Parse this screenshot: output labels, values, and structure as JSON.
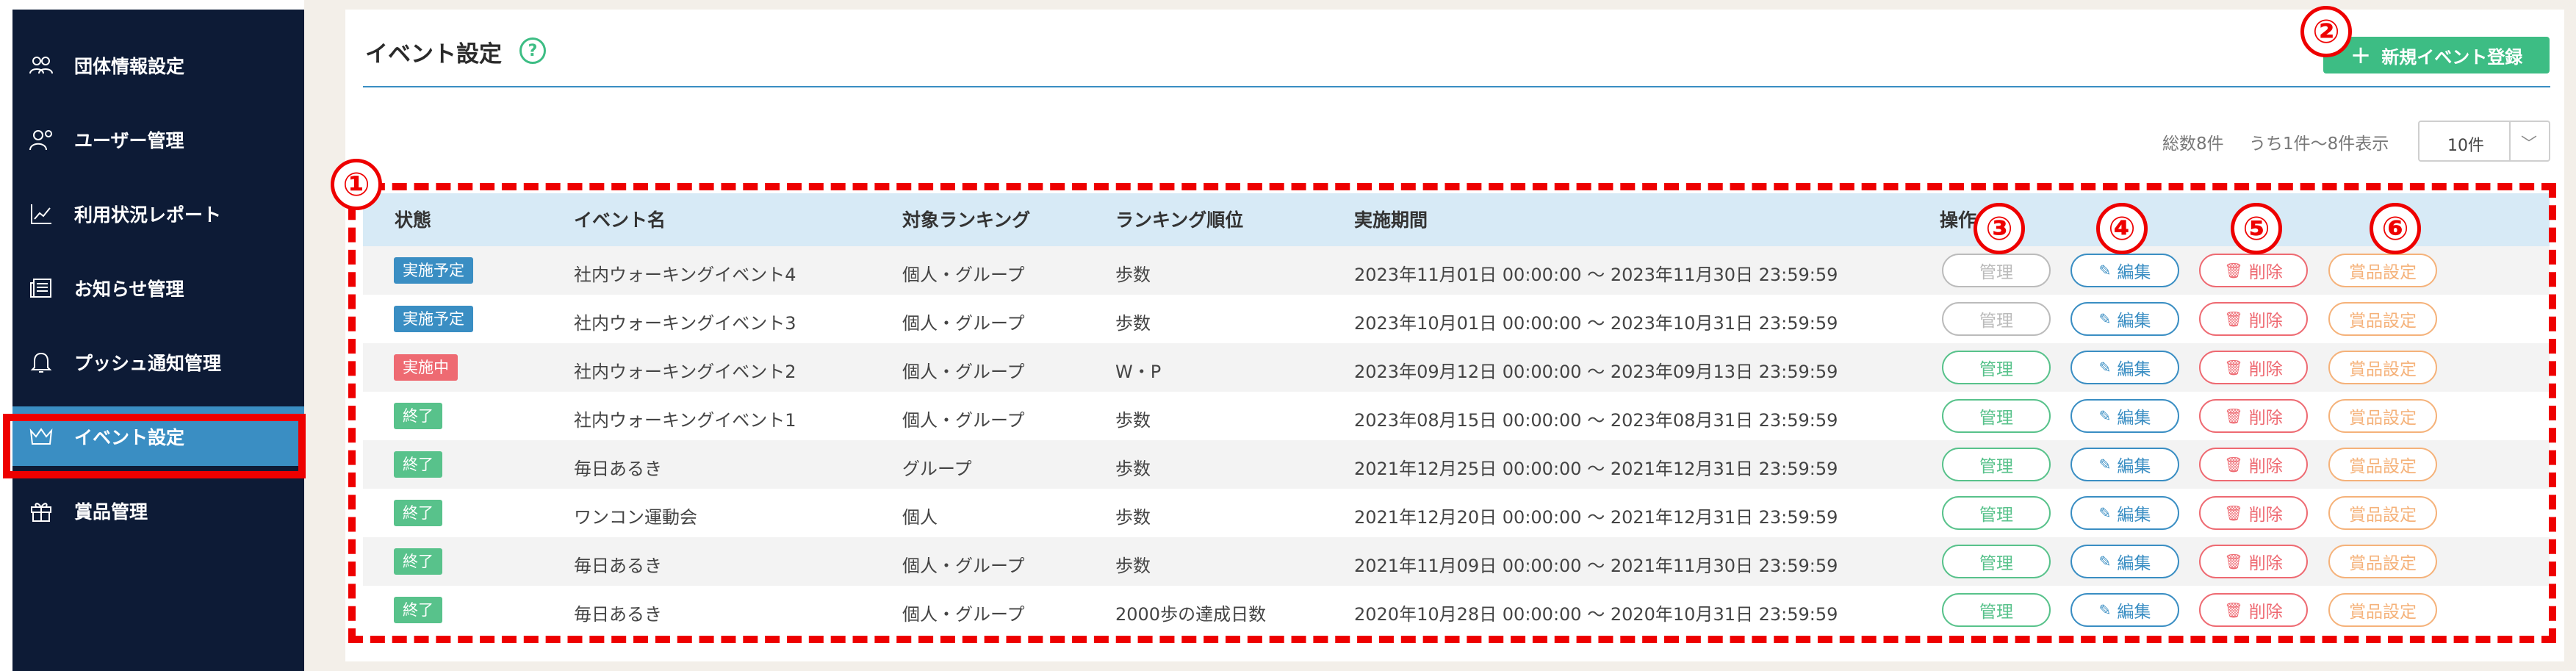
{
  "sidebar": {
    "items": [
      {
        "label": "団体情報設定",
        "icon": "group-icon"
      },
      {
        "label": "ユーザー管理",
        "icon": "user-settings-icon"
      },
      {
        "label": "利用状況レポート",
        "icon": "chart-icon"
      },
      {
        "label": "お知らせ管理",
        "icon": "newspaper-icon"
      },
      {
        "label": "プッシュ通知管理",
        "icon": "bell-icon"
      },
      {
        "label": "イベント設定",
        "icon": "crown-icon",
        "active": true
      },
      {
        "label": "賞品管理",
        "icon": "gift-icon"
      }
    ]
  },
  "page": {
    "title": "イベント設定",
    "help": "?",
    "new_event_label": "新規イベント登録",
    "plus": "+"
  },
  "summary": {
    "total": "総数8件",
    "range": "うち1件〜8件表示",
    "per_page": "10件",
    "chevron": "﹀"
  },
  "annotations": [
    "①",
    "②",
    "③",
    "④",
    "⑤",
    "⑥"
  ],
  "table": {
    "headers": {
      "status": "状態",
      "name": "イベント名",
      "target": "対象ランキング",
      "order": "ランキング順位",
      "period": "実施期間",
      "ops": "操作"
    },
    "buttons": {
      "manage": "管理",
      "edit": "編集",
      "delete": "削除",
      "prize": "賞品設定"
    },
    "rows": [
      {
        "status": "実施予定",
        "kind": "planned",
        "name": "社内ウォーキングイベント4",
        "target": "個人・グループ",
        "order": "歩数",
        "period": "2023年11月01日 00:00:00 〜 2023年11月30日 23:59:59",
        "manage_disabled": true
      },
      {
        "status": "実施予定",
        "kind": "planned",
        "name": "社内ウォーキングイベント3",
        "target": "個人・グループ",
        "order": "歩数",
        "period": "2023年10月01日 00:00:00 〜 2023年10月31日 23:59:59",
        "manage_disabled": true
      },
      {
        "status": "実施中",
        "kind": "active",
        "name": "社内ウォーキングイベント2",
        "target": "個人・グループ",
        "order": "W・P",
        "period": "2023年09月12日 00:00:00 〜 2023年09月13日 23:59:59",
        "manage_disabled": false
      },
      {
        "status": "終了",
        "kind": "ended",
        "name": "社内ウォーキングイベント1",
        "target": "個人・グループ",
        "order": "歩数",
        "period": "2023年08月15日 00:00:00 〜 2023年08月31日 23:59:59",
        "manage_disabled": false
      },
      {
        "status": "終了",
        "kind": "ended",
        "name": "毎日あるき",
        "target": "グループ",
        "order": "歩数",
        "period": "2021年12月25日 00:00:00 〜 2021年12月31日 23:59:59",
        "manage_disabled": false
      },
      {
        "status": "終了",
        "kind": "ended",
        "name": "ワンコン運動会",
        "target": "個人",
        "order": "歩数",
        "period": "2021年12月20日 00:00:00 〜 2021年12月31日 23:59:59",
        "manage_disabled": false
      },
      {
        "status": "終了",
        "kind": "ended",
        "name": "毎日あるき",
        "target": "個人・グループ",
        "order": "歩数",
        "period": "2021年11月09日 00:00:00 〜 2021年11月30日 23:59:59",
        "manage_disabled": false
      },
      {
        "status": "終了",
        "kind": "ended",
        "name": "毎日あるき",
        "target": "個人・グループ",
        "order": "2000歩の達成日数",
        "period": "2020年10月28日 00:00:00 〜 2020年10月31日 23:59:59",
        "manage_disabled": false
      }
    ]
  },
  "colors": {
    "sidebar_bg": "#0d1b36",
    "active_bg": "#3a8ec3",
    "planned": "#3a8ec3",
    "active": "#ee6a72",
    "ended": "#58c28b",
    "manage": "#58c28b",
    "edit": "#3a8ec3",
    "delete": "#ee6a72",
    "prize": "#f5b27a",
    "annotation_red": "#ee0000"
  }
}
